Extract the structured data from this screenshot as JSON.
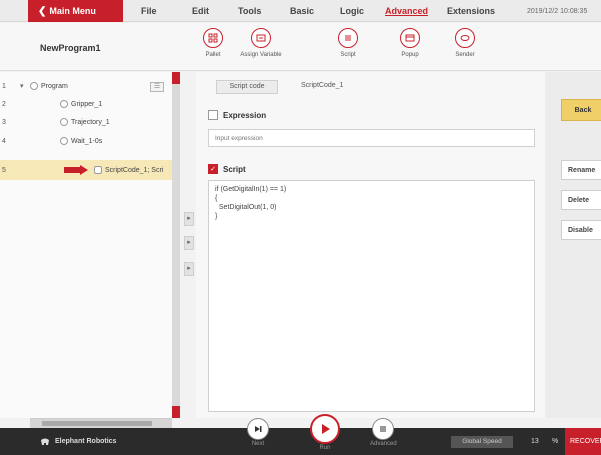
{
  "topbar": {
    "main_menu_label": "Main Menu",
    "menus": [
      "File",
      "Edit",
      "Tools",
      "Basic",
      "Logic",
      "Advanced",
      "Extensions"
    ],
    "active_menu": "Advanced",
    "datetime": "2019/12/2 10:08:35"
  },
  "toolbar": {
    "program_title": "NewProgram1",
    "tools": [
      {
        "label": "Pallet",
        "icon": "pallet-icon"
      },
      {
        "label": "Assign Variable",
        "icon": "assign-variable-icon"
      },
      {
        "label": "Script",
        "icon": "script-icon"
      },
      {
        "label": "Popup",
        "icon": "popup-icon"
      },
      {
        "label": "Sender",
        "icon": "sender-icon"
      }
    ]
  },
  "tree": {
    "rows": [
      {
        "num": "1",
        "label": "Program",
        "expander": "▾"
      },
      {
        "num": "2",
        "label": "Gripper_1"
      },
      {
        "num": "3",
        "label": "Trajectory_1"
      },
      {
        "num": "4",
        "label": "Wait_1-0s"
      },
      {
        "num": "5",
        "label": "ScriptCode_1; Scri",
        "selected": true
      }
    ]
  },
  "editor": {
    "script_code_button": "Script code",
    "script_name": "ScriptCode_1",
    "expression_label": "Expression",
    "expression_placeholder": "Input expression",
    "expression_checked": false,
    "script_label": "Script",
    "script_checked": true,
    "script_lines": [
      "if (GetDigitalIn(1) == 1)",
      "{",
      "  SetDigitalOut(1, 0)",
      "}"
    ]
  },
  "right_panel": {
    "back_label": "Back",
    "buttons": [
      "Rename",
      "Delete",
      "Disable"
    ]
  },
  "bottombar": {
    "brand": "Elephant Robotics",
    "controls": [
      {
        "label": "Next",
        "icon": "next-icon"
      },
      {
        "label": "Run",
        "icon": "play-icon"
      },
      {
        "label": "Advanced",
        "icon": "advanced-icon"
      }
    ],
    "global_speed_label": "Global Speed",
    "speed_value": "13",
    "speed_unit": "%",
    "status": "RECOVER"
  },
  "colors": {
    "accent": "#c8202a",
    "selected_row": "#f7e9b7",
    "back_button": "#f1cf68"
  }
}
